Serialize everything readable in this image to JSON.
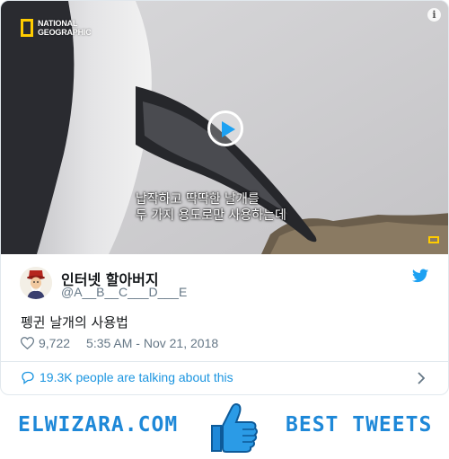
{
  "video": {
    "brand": [
      "NATIONAL",
      "GEOGRAPHIC"
    ],
    "subtitle_line1": "납작하고 딱딱한 날개를",
    "subtitle_line2": "두 가지 용도로만 사용하는데",
    "info_icon": "info-icon",
    "play_icon": "play-icon"
  },
  "user": {
    "name": "인터넷 할아버지",
    "handle": "@A__B__C___D___E"
  },
  "tweet": {
    "text": "펭귄 날개의 사용법",
    "likes": "9,722",
    "timestamp": "5:35 AM - Nov 21, 2018",
    "talking": "19.3K people are talking about this"
  },
  "banner": {
    "left": "ELWIZARA.COM",
    "right": "BEST TWEETS"
  },
  "colors": {
    "twitter_blue": "#1da1f2",
    "link_blue": "#1b95e0",
    "banner_blue": "#1e88d8",
    "ng_yellow": "#ffcc00"
  }
}
